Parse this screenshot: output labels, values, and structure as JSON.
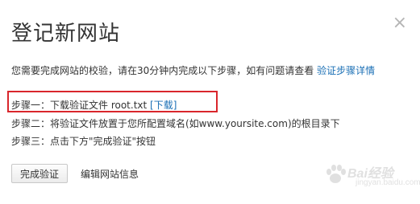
{
  "dialog": {
    "title": "登记新网站",
    "close_glyph": "×",
    "description": "您需要完成网站的校验，请在30分钟内完成以下步骤，如有问题请查看 ",
    "description_link": "验证步骤详情",
    "steps": [
      {
        "text": "步骤一：下载验证文件 root.txt ",
        "link": "[下载]"
      },
      {
        "text": "步骤二：将验证文件放置于您所配置域名(如www.yoursite.com)的根目录下"
      },
      {
        "text": "步骤三：点击下方\"完成验证\"按钮"
      }
    ],
    "complete_button": "完成验证",
    "edit_link": "编辑网站信息"
  },
  "watermark": {
    "brand": "Bai",
    "brand_suffix": "经验",
    "sub": "jingyan.baidu.com"
  },
  "colors": {
    "link": "#1a6fb5",
    "highlight_border": "#d9262c",
    "text": "#333333"
  },
  "icons": {
    "close": "close-icon",
    "watermark": "baidu-paw-icon"
  }
}
